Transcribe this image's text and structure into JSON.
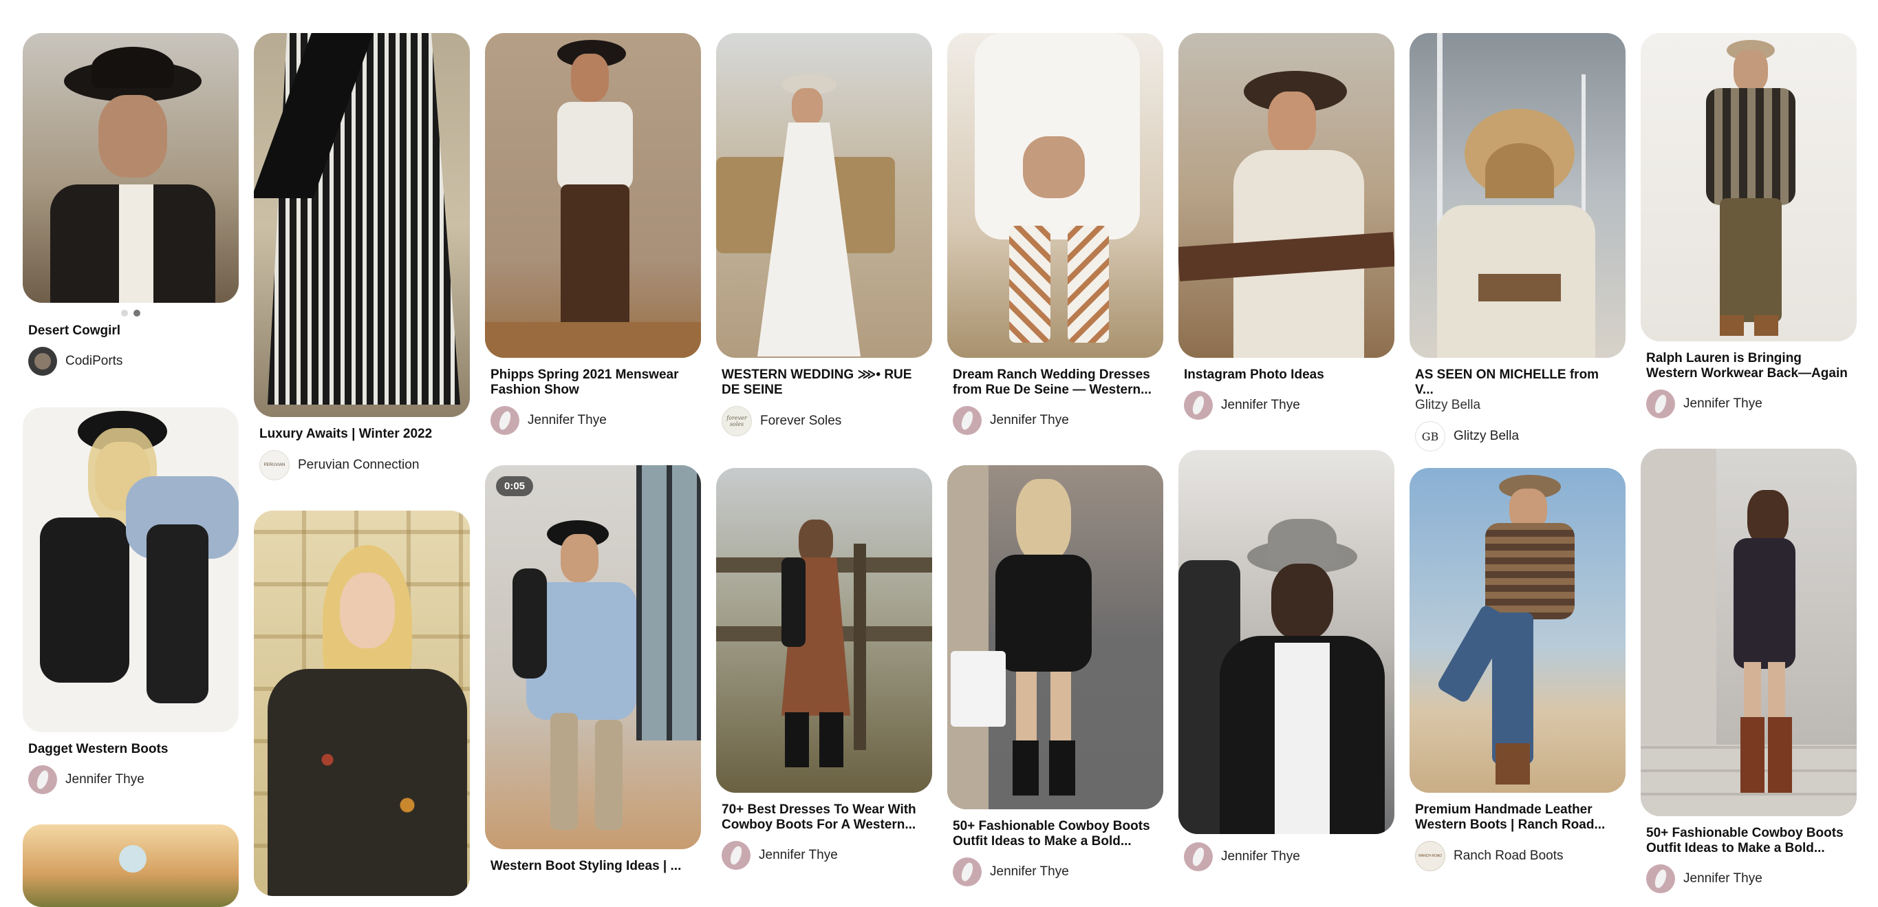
{
  "pins": {
    "desert_cowgirl": {
      "title": "Desert Cowgirl",
      "creator": "CodiPorts"
    },
    "luxury": {
      "title": "Luxury Awaits | Winter 2022",
      "creator": "Peruvian Connection",
      "avatar_text": "PERUVIAN"
    },
    "phipps": {
      "title": "Phipps Spring 2021 Menswear Fashion Show",
      "creator": "Jennifer Thye"
    },
    "western_wedding": {
      "title": "WESTERN WEDDING ⋙• RUE DE SEINE",
      "creator": "Forever Soles",
      "avatar_text": "forever soles"
    },
    "dream_ranch": {
      "title": "Dream Ranch Wedding Dresses from Rue De Seine — Western...",
      "creator": "Jennifer Thye"
    },
    "instagram": {
      "title": "Instagram Photo Ideas",
      "creator": "Jennifer Thye"
    },
    "as_seen": {
      "title": "AS SEEN ON MICHELLE from V...",
      "subtitle": "Glitzy Bella",
      "creator": "Glitzy Bella",
      "avatar_text": "GB"
    },
    "ralph": {
      "title": "Ralph Lauren is Bringing Western Workwear Back—Again",
      "creator": "Jennifer Thye"
    },
    "dagget": {
      "title": "Dagget Western Boots",
      "creator": "Jennifer Thye"
    },
    "western_boot": {
      "title": "Western Boot Styling Ideas | ...",
      "video_duration": "0:05"
    },
    "dresses70": {
      "title": "70+ Best Dresses To Wear With Cowboy Boots For A Western...",
      "creator": "Jennifer Thye"
    },
    "fifty_a": {
      "title": "50+ Fashionable Cowboy Boots Outfit Ideas to Make a Bold...",
      "creator": "Jennifer Thye"
    },
    "man_hat": {
      "creator": "Jennifer Thye"
    },
    "premium": {
      "title": "Premium Handmade Leather Western Boots | Ranch Road...",
      "creator": "Ranch Road Boots",
      "avatar_text": "RANCH ROAD"
    },
    "fifty_b": {
      "title": "50+ Fashionable Cowboy Boots Outfit Ideas to Make a Bold...",
      "creator": "Jennifer Thye"
    }
  },
  "colors": {
    "text": "#111111",
    "creator_avatar": "#b89a9a",
    "background": "#ffffff"
  }
}
